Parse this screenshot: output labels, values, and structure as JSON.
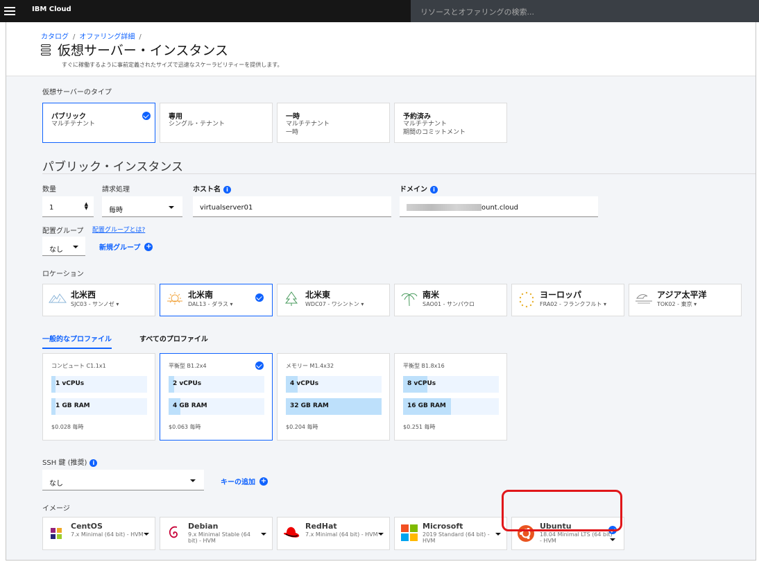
{
  "topbar": {
    "brand": "IBM Cloud",
    "search_placeholder": "リソースとオファリングの検索..."
  },
  "header": {
    "breadcrumbs": [
      "カタログ",
      "オファリング詳細"
    ],
    "title": "仮想サーバー・インスタンス",
    "subtitle": "すぐに稼働するように事前定義されたサイズで迅速なスケーラビリティーを提供します。"
  },
  "server_types": {
    "label": "仮想サーバーのタイプ",
    "items": [
      {
        "title": "パブリック",
        "lines": [
          "マルチテナント"
        ],
        "selected": true
      },
      {
        "title": "専用",
        "lines": [
          "シングル・テナント"
        ],
        "selected": false
      },
      {
        "title": "一時",
        "lines": [
          "マルチテナント",
          "一時"
        ],
        "selected": false
      },
      {
        "title": "予約済み",
        "lines": [
          "マルチテナント",
          "期間のコミットメント"
        ],
        "selected": false
      }
    ]
  },
  "section_title": "パブリック・インスタンス",
  "form": {
    "quantity_label": "数量",
    "quantity_value": "1",
    "billing_label": "請求処理",
    "billing_value": "毎時",
    "hostname_label": "ホスト名",
    "hostname_value": "virtualserver01",
    "domain_label": "ドメイン",
    "domain_value": "ount.cloud",
    "placement_label": "配置グループ",
    "placement_link": "配置グループとは?",
    "placement_value": "なし",
    "new_group": "新規グループ"
  },
  "location": {
    "label": "ロケーション",
    "items": [
      {
        "name": "北米西",
        "dc": "SJC03 - サンノゼ",
        "icon": "mountain-icon",
        "selected": false
      },
      {
        "name": "北米南",
        "dc": "DAL13 - ダラス",
        "icon": "sun-icon",
        "selected": true
      },
      {
        "name": "北米東",
        "dc": "WDC07 - ワシントン",
        "icon": "tree-icon",
        "selected": false
      },
      {
        "name": "南米",
        "dc": "SAO01 - サンパウロ",
        "icon": "palm-icon",
        "selected": false
      },
      {
        "name": "ヨーロッパ",
        "dc": "FRA02 - フランクフルト",
        "icon": "stars-icon",
        "selected": false
      },
      {
        "name": "アジア太平洋",
        "dc": "TOK02 - 東京",
        "icon": "wave-icon",
        "selected": false
      }
    ]
  },
  "profile_tabs": {
    "common": "一般的なプロファイル",
    "all": "すべてのプロファイル"
  },
  "profiles": [
    {
      "name": "コンピュート C1.1x1",
      "cpu": "1 vCPUs",
      "ram": "1 GB RAM",
      "price": "$0.028 毎時",
      "cpu_level": 0.04,
      "ram_level": 0.04,
      "selected": false
    },
    {
      "name": "平衡型 B1.2x4",
      "cpu": "2 vCPUs",
      "ram": "4 GB RAM",
      "price": "$0.063 毎時",
      "cpu_level": 0.06,
      "ram_level": 0.12,
      "selected": true
    },
    {
      "name": "メモリー M1.4x32",
      "cpu": "4 vCPUs",
      "ram": "32 GB RAM",
      "price": "$0.204 毎時",
      "cpu_level": 0.12,
      "ram_level": 1.0,
      "selected": false
    },
    {
      "name": "平衡型 B1.8x16",
      "cpu": "8 vCPUs",
      "ram": "16 GB RAM",
      "price": "$0.251 毎時",
      "cpu_level": 0.25,
      "ram_level": 0.5,
      "selected": false
    }
  ],
  "ssh": {
    "label": "SSH 鍵 (推奨)",
    "value": "なし",
    "add": "キーの追加"
  },
  "images": {
    "label": "イメージ",
    "items": [
      {
        "name": "CentOS",
        "sub": "7.x Minimal (64 bit) - HVM",
        "icon": "centos-logo-icon",
        "selected": false
      },
      {
        "name": "Debian",
        "sub": "9.x Minimal Stable (64 bit) - HVM",
        "icon": "debian-logo-icon",
        "selected": false
      },
      {
        "name": "RedHat",
        "sub": "7.x Minimal (64 bit) - HVM",
        "icon": "redhat-logo-icon",
        "selected": false
      },
      {
        "name": "Microsoft",
        "sub": "2019 Standard (64 bit) - HVM",
        "icon": "microsoft-logo-icon",
        "selected": false
      },
      {
        "name": "Ubuntu",
        "sub": "18.04 Minimal LTS (64 bit) - HVM",
        "icon": "ubuntu-logo-icon",
        "selected": true
      }
    ]
  },
  "colors": {
    "accent": "#0f62fe",
    "highlight": "#e0161a",
    "topbar": "#161616"
  }
}
